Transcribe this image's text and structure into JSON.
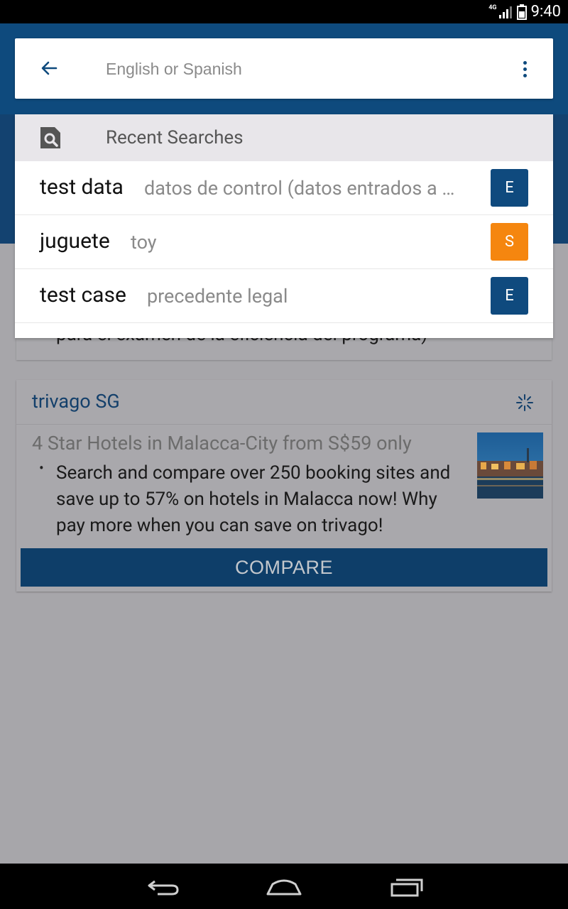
{
  "status_bar": {
    "time": "9:40",
    "network": "4G"
  },
  "search": {
    "placeholder": "English or Spanish",
    "value": ""
  },
  "recent": {
    "title": "Recent Searches",
    "items": [
      {
        "word": "test data",
        "translation": "datos de control (datos entrados a …",
        "lang": "E",
        "lang_color": "#0f4a7e"
      },
      {
        "word": "juguete",
        "translation": "toy",
        "lang": "S",
        "lang_color": "#f5860f"
      },
      {
        "word": "test case",
        "translation": "precedente legal",
        "lang": "E",
        "lang_color": "#0f4a7e"
      }
    ]
  },
  "partial_text": "para el examen de la eficiencia del programa)",
  "ad": {
    "brand": "trivago SG",
    "headline": "4 Star Hotels in Malacca-City from S$59 only",
    "bullet": "•",
    "body": "Search and compare over 250 booking sites and save up to 57% on hotels in Malacca now! Why pay more when you can save on trivago!",
    "cta": "COMPARE"
  },
  "colors": {
    "primary": "#0e4a7d",
    "badge_english": "#0f4a7e",
    "badge_spanish": "#f5860f"
  }
}
